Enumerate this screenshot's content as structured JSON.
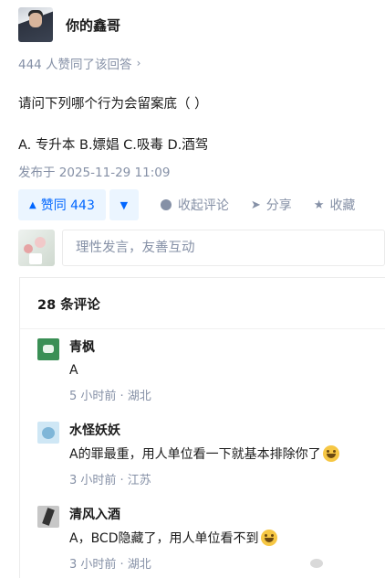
{
  "answer": {
    "author_name": "你的鑫哥",
    "upvote_note": "444 人赞同了该回答",
    "question": "请问下列哪个行为会留案底（ ）",
    "options": "A. 专升本 B.嫖娼 C.吸毒 D.酒驾",
    "published": "发布于 2025-11-29 11:09"
  },
  "actions": {
    "upvote_label": "赞同 443",
    "collapse_comments": "收起评论",
    "share": "分享",
    "favorite": "收藏"
  },
  "composer": {
    "placeholder": "理性发言，友善互动"
  },
  "comments": {
    "title": "28 条评论",
    "items": [
      {
        "name": "青枫",
        "text": "A",
        "meta": "5 小时前 · 湖北"
      },
      {
        "name": "水怪妖妖",
        "text": "A的罪最重，用人单位看一下就基本排除你了",
        "meta": "3 小时前 · 江苏"
      },
      {
        "name": "清风入酒",
        "text": "A，BCD隐藏了，用人单位看不到",
        "meta": "3 小时前 · 湖北"
      }
    ]
  },
  "colors": {
    "accent": "#0066ff",
    "accent_bg": "#ebf5ff",
    "muted": "#8590a6"
  },
  "icons": {
    "upvote": "triangle-up-icon",
    "downvote": "triangle-down-icon",
    "comment": "comment-bubble-icon",
    "share": "paper-plane-icon",
    "favorite": "star-icon",
    "chevron": "chevron-right-icon"
  }
}
